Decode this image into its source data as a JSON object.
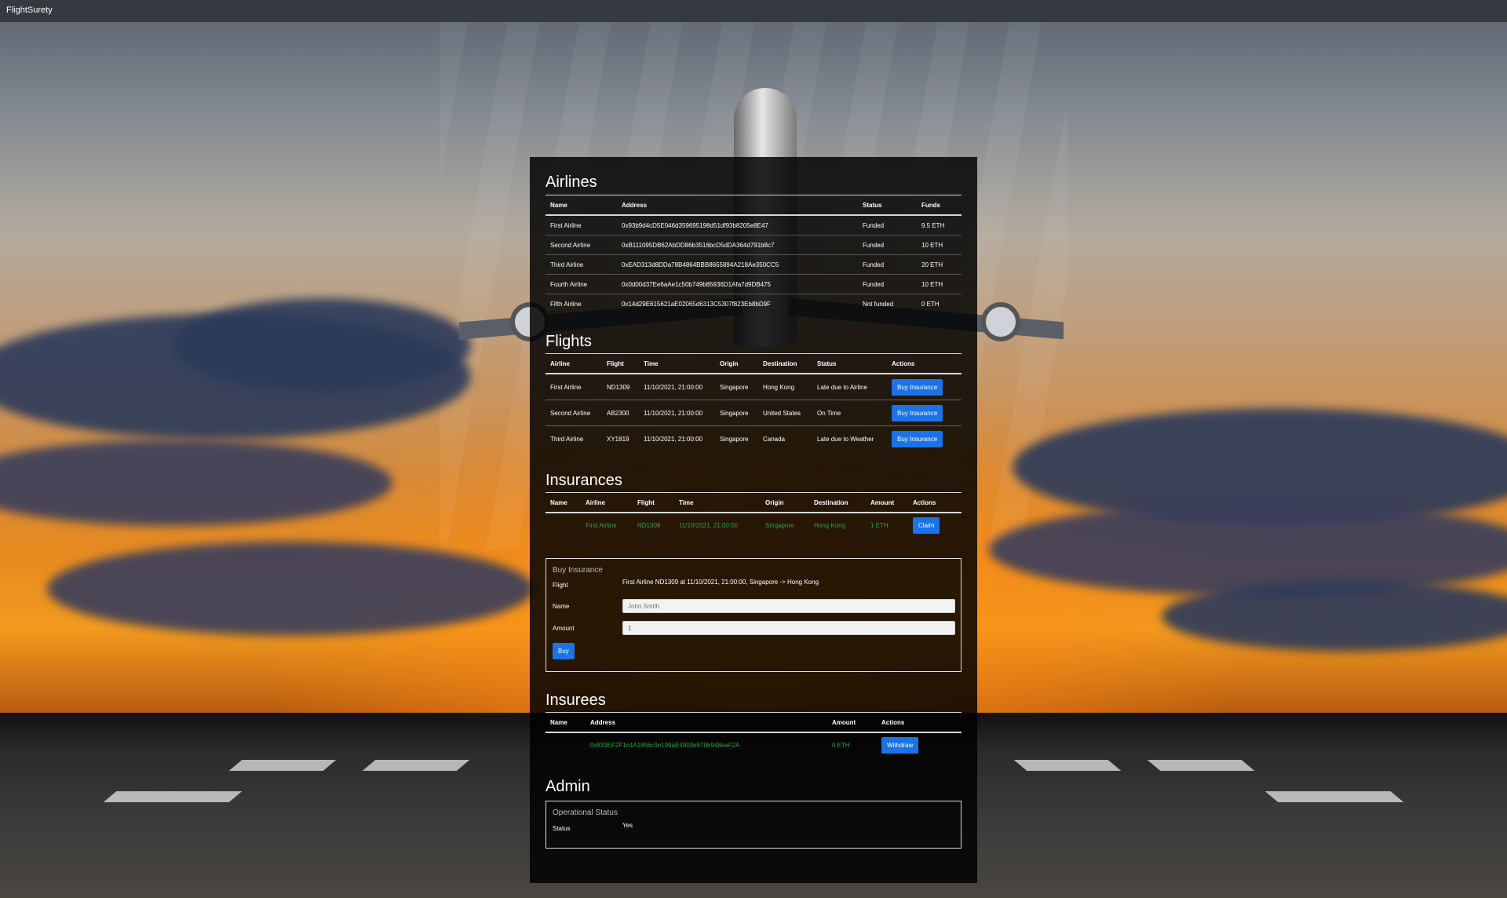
{
  "app": {
    "brand": "FlightSurety"
  },
  "airlines": {
    "title": "Airlines",
    "headers": [
      "Name",
      "Address",
      "Status",
      "Funds"
    ],
    "rows": [
      [
        "First Airline",
        "0x93b9d4cD5E046d359695198d51df93b8205e8E47",
        "Funded",
        "9.5 ETH"
      ],
      [
        "Second Airline",
        "0xB111095DB62AbDD86b3516bcD5dDA364d791b8c7",
        "Funded",
        "10 ETH"
      ],
      [
        "Third Airline",
        "0xEAD313d8DDa78B4864BBB8655894A218Ae350CC5",
        "Funded",
        "20 ETH"
      ],
      [
        "Fourth Airline",
        "0x0d00d37Ee6aAe1c50b749b85936D1Afa7d9DB475",
        "Funded",
        "10 ETH"
      ],
      [
        "Fifth Airline",
        "0x14d29E615621aE02065d6313C5307f823Eb8bD9F",
        "Not funded",
        "0 ETH"
      ]
    ]
  },
  "flights": {
    "title": "Flights",
    "headers": [
      "Airline",
      "Flight",
      "Time",
      "Origin",
      "Destination",
      "Status",
      "Actions"
    ],
    "rows": [
      [
        "First Airline",
        "ND1309",
        "11/10/2021, 21:00:00",
        "Singapore",
        "Hong Kong",
        "Late due to Airline",
        "Buy Insurance"
      ],
      [
        "Second Airline",
        "AB2300",
        "11/10/2021, 21:00:00",
        "Singapore",
        "United States",
        "On Time",
        "Buy Insurance"
      ],
      [
        "Third Airline",
        "XY1819",
        "11/10/2021, 21:00:00",
        "Singapore",
        "Canada",
        "Late due to Weather",
        "Buy Insurance"
      ]
    ]
  },
  "insurances": {
    "title": "Insurances",
    "headers": [
      "Name",
      "Airline",
      "Flight",
      "Time",
      "Origin",
      "Destination",
      "Amount",
      "Actions"
    ],
    "rows": [
      [
        "",
        "First Airline",
        "ND1309",
        "11/10/2021, 21:00:00",
        "Singapore",
        "Hong Kong",
        "1 ETH",
        "Claim"
      ]
    ]
  },
  "buy_form": {
    "legend": "Buy Insurance",
    "flight_label": "Flight",
    "flight_value": "First Airline ND1309 at 11/10/2021, 21:00:00, Singapore -> Hong Kong",
    "name_label": "Name",
    "name_placeholder": "John Smith",
    "amount_label": "Amount",
    "amount_value": "1",
    "buy_label": "Buy"
  },
  "insurees": {
    "title": "Insurees",
    "headers": [
      "Name",
      "Address",
      "Amount",
      "Actions"
    ],
    "rows": [
      [
        "",
        "0x833EF2F1c4A1856c9e199aE4903e970b948eaF2A",
        "0 ETH",
        "Withdraw"
      ]
    ]
  },
  "admin": {
    "title": "Admin",
    "legend": "Operational Status",
    "status_label": "Status",
    "status_value": "Yes"
  },
  "colors": {
    "topbar": "#343a40",
    "primary_button": "#1a73e8",
    "insured_text": "#27a744"
  }
}
